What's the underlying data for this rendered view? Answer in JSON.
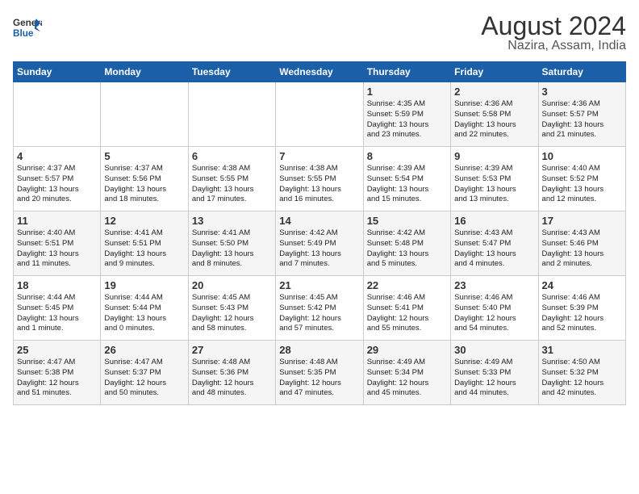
{
  "header": {
    "logo_line1": "General",
    "logo_line2": "Blue",
    "title": "August 2024",
    "subtitle": "Nazira, Assam, India"
  },
  "days_of_week": [
    "Sunday",
    "Monday",
    "Tuesday",
    "Wednesday",
    "Thursday",
    "Friday",
    "Saturday"
  ],
  "weeks": [
    [
      {
        "num": "",
        "info": ""
      },
      {
        "num": "",
        "info": ""
      },
      {
        "num": "",
        "info": ""
      },
      {
        "num": "",
        "info": ""
      },
      {
        "num": "1",
        "info": "Sunrise: 4:35 AM\nSunset: 5:59 PM\nDaylight: 13 hours\nand 23 minutes."
      },
      {
        "num": "2",
        "info": "Sunrise: 4:36 AM\nSunset: 5:58 PM\nDaylight: 13 hours\nand 22 minutes."
      },
      {
        "num": "3",
        "info": "Sunrise: 4:36 AM\nSunset: 5:57 PM\nDaylight: 13 hours\nand 21 minutes."
      }
    ],
    [
      {
        "num": "4",
        "info": "Sunrise: 4:37 AM\nSunset: 5:57 PM\nDaylight: 13 hours\nand 20 minutes."
      },
      {
        "num": "5",
        "info": "Sunrise: 4:37 AM\nSunset: 5:56 PM\nDaylight: 13 hours\nand 18 minutes."
      },
      {
        "num": "6",
        "info": "Sunrise: 4:38 AM\nSunset: 5:55 PM\nDaylight: 13 hours\nand 17 minutes."
      },
      {
        "num": "7",
        "info": "Sunrise: 4:38 AM\nSunset: 5:55 PM\nDaylight: 13 hours\nand 16 minutes."
      },
      {
        "num": "8",
        "info": "Sunrise: 4:39 AM\nSunset: 5:54 PM\nDaylight: 13 hours\nand 15 minutes."
      },
      {
        "num": "9",
        "info": "Sunrise: 4:39 AM\nSunset: 5:53 PM\nDaylight: 13 hours\nand 13 minutes."
      },
      {
        "num": "10",
        "info": "Sunrise: 4:40 AM\nSunset: 5:52 PM\nDaylight: 13 hours\nand 12 minutes."
      }
    ],
    [
      {
        "num": "11",
        "info": "Sunrise: 4:40 AM\nSunset: 5:51 PM\nDaylight: 13 hours\nand 11 minutes."
      },
      {
        "num": "12",
        "info": "Sunrise: 4:41 AM\nSunset: 5:51 PM\nDaylight: 13 hours\nand 9 minutes."
      },
      {
        "num": "13",
        "info": "Sunrise: 4:41 AM\nSunset: 5:50 PM\nDaylight: 13 hours\nand 8 minutes."
      },
      {
        "num": "14",
        "info": "Sunrise: 4:42 AM\nSunset: 5:49 PM\nDaylight: 13 hours\nand 7 minutes."
      },
      {
        "num": "15",
        "info": "Sunrise: 4:42 AM\nSunset: 5:48 PM\nDaylight: 13 hours\nand 5 minutes."
      },
      {
        "num": "16",
        "info": "Sunrise: 4:43 AM\nSunset: 5:47 PM\nDaylight: 13 hours\nand 4 minutes."
      },
      {
        "num": "17",
        "info": "Sunrise: 4:43 AM\nSunset: 5:46 PM\nDaylight: 13 hours\nand 2 minutes."
      }
    ],
    [
      {
        "num": "18",
        "info": "Sunrise: 4:44 AM\nSunset: 5:45 PM\nDaylight: 13 hours\nand 1 minute."
      },
      {
        "num": "19",
        "info": "Sunrise: 4:44 AM\nSunset: 5:44 PM\nDaylight: 13 hours\nand 0 minutes."
      },
      {
        "num": "20",
        "info": "Sunrise: 4:45 AM\nSunset: 5:43 PM\nDaylight: 12 hours\nand 58 minutes."
      },
      {
        "num": "21",
        "info": "Sunrise: 4:45 AM\nSunset: 5:42 PM\nDaylight: 12 hours\nand 57 minutes."
      },
      {
        "num": "22",
        "info": "Sunrise: 4:46 AM\nSunset: 5:41 PM\nDaylight: 12 hours\nand 55 minutes."
      },
      {
        "num": "23",
        "info": "Sunrise: 4:46 AM\nSunset: 5:40 PM\nDaylight: 12 hours\nand 54 minutes."
      },
      {
        "num": "24",
        "info": "Sunrise: 4:46 AM\nSunset: 5:39 PM\nDaylight: 12 hours\nand 52 minutes."
      }
    ],
    [
      {
        "num": "25",
        "info": "Sunrise: 4:47 AM\nSunset: 5:38 PM\nDaylight: 12 hours\nand 51 minutes."
      },
      {
        "num": "26",
        "info": "Sunrise: 4:47 AM\nSunset: 5:37 PM\nDaylight: 12 hours\nand 50 minutes."
      },
      {
        "num": "27",
        "info": "Sunrise: 4:48 AM\nSunset: 5:36 PM\nDaylight: 12 hours\nand 48 minutes."
      },
      {
        "num": "28",
        "info": "Sunrise: 4:48 AM\nSunset: 5:35 PM\nDaylight: 12 hours\nand 47 minutes."
      },
      {
        "num": "29",
        "info": "Sunrise: 4:49 AM\nSunset: 5:34 PM\nDaylight: 12 hours\nand 45 minutes."
      },
      {
        "num": "30",
        "info": "Sunrise: 4:49 AM\nSunset: 5:33 PM\nDaylight: 12 hours\nand 44 minutes."
      },
      {
        "num": "31",
        "info": "Sunrise: 4:50 AM\nSunset: 5:32 PM\nDaylight: 12 hours\nand 42 minutes."
      }
    ]
  ]
}
